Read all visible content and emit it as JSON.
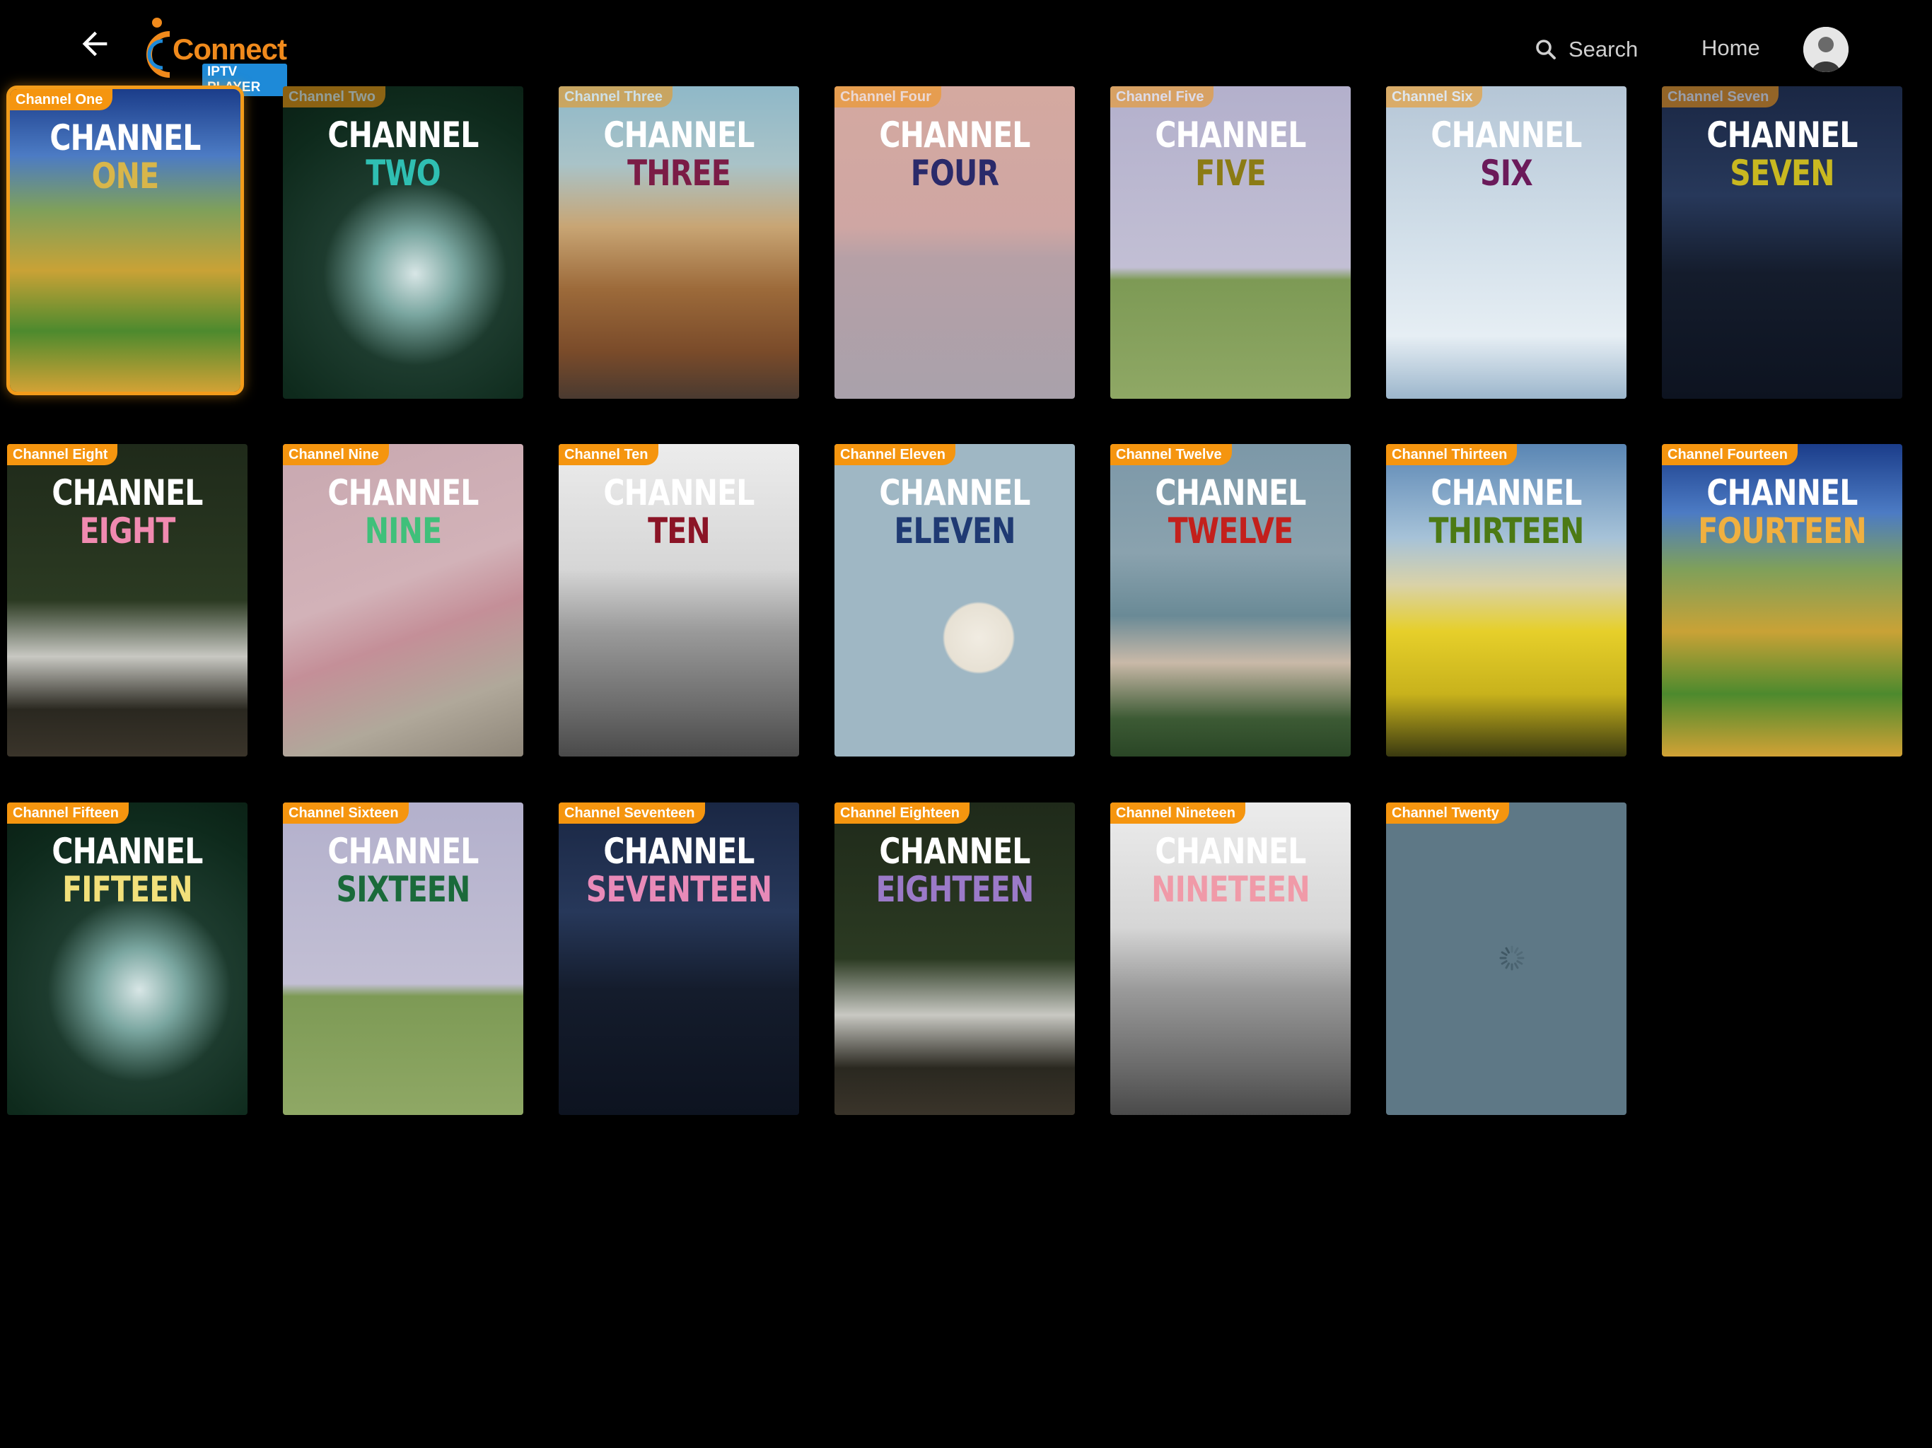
{
  "header": {
    "logo_word": "Connect",
    "logo_badge": "IPTV PLAYER",
    "search_label": "Search",
    "home_label": "Home"
  },
  "colors": {
    "accent": "#f5950f",
    "logo_blue": "#1e8ad8",
    "background": "#000000"
  },
  "channels": [
    {
      "tag": "Channel One",
      "line1": "CHANNEL",
      "line2": "ONE",
      "line2_color": "#d8b64a",
      "bg": "linear-gradient(180deg,#1b3d8a 0%,#4c7bc4 22%,#7fa05a 40%,#c9a236 60%,#4d8a2e 80%,#d2a235 100%)"
    },
    {
      "tag": "Channel Two",
      "line1": "CHANNEL",
      "line2": "TWO",
      "line2_color": "#2fbfb2",
      "bg": "radial-gradient(circle at 55% 60%,#d8e6e6 0%,#7aa6a0 18%,#1d3b2e 40%,#0e2a1c 75%,#0a1f14 100%)"
    },
    {
      "tag": "Channel Three",
      "line1": "CHANNEL",
      "line2": "THREE",
      "line2_color": "#7b1c46",
      "bg": "linear-gradient(180deg,#8fb8c8 0%,#a9c3c8 25%,#c8a574 45%,#9c6a3a 65%,#7a4b2a 85%,#4a3a30 100%)"
    },
    {
      "tag": "Channel Four",
      "line1": "CHANNEL",
      "line2": "FOUR",
      "line2_color": "#2a2a6a",
      "bg": "linear-gradient(180deg,#d4a9a0 0%,#cfa6a3 45%,#b6a0a6 55%,#a9a1ab 100%)"
    },
    {
      "tag": "Channel Five",
      "line1": "CHANNEL",
      "line2": "FIVE",
      "line2_color": "#8b7b14",
      "bg": "linear-gradient(180deg,#b3b0cc 0%,#c2bfd4 58%,#7d9a55 62%,#8fa865 100%)"
    },
    {
      "tag": "Channel Six",
      "line1": "CHANNEL",
      "line2": "SIX",
      "line2_color": "#6b1a5a",
      "bg": "linear-gradient(180deg,#b5c6d6 0%,#d3e0ea 50%,#e6eef4 80%,#9cb6cc 100%)"
    },
    {
      "tag": "Channel Seven",
      "line1": "CHANNEL",
      "line2": "SEVEN",
      "line2_color": "#c9b820",
      "bg": "linear-gradient(180deg,#1a2744 0%,#27385a 35%,#141c2c 60%,#0d1320 100%)"
    },
    {
      "tag": "Channel Eight",
      "line1": "CHANNEL",
      "line2": "EIGHT",
      "line2_color": "#f08ab0",
      "bg": "linear-gradient(180deg,#1f2a1a 0%,#2b3a22 50%,#c8c8c2 68%,#2a2820 85%,#3a342a 100%)"
    },
    {
      "tag": "Channel Nine",
      "line1": "CHANNEL",
      "line2": "NINE",
      "line2_color": "#3fc07a",
      "bg": "linear-gradient(160deg,#c8a8b0 0%,#d2b2b8 45%,#c48f98 60%,#b0a89a 80%,#8e8679 100%)"
    },
    {
      "tag": "Channel Ten",
      "line1": "CHANNEL",
      "line2": "TEN",
      "line2_color": "#8b1426",
      "bg": "linear-gradient(180deg,#ececec 0%,#d6d6d6 40%,#9a9a9a 60%,#6a6a6a 85%,#4a4a4a 100%)"
    },
    {
      "tag": "Channel Eleven",
      "line1": "CHANNEL",
      "line2": "ELEVEN",
      "line2_color": "#1f3a73",
      "bg": "radial-gradient(circle at 60% 62%,#f1ece2 0%,#e7e1d4 14%,#9fb7c4 15%,#9fb7c4 100%)"
    },
    {
      "tag": "Channel Twelve",
      "line1": "CHANNEL",
      "line2": "TWELVE",
      "line2_color": "#c3201c",
      "bg": "linear-gradient(180deg,#7c98a8 0%,#8aa2ae 35%,#6a8a96 55%,#c9b9a8 70%,#3c5a34 88%,#2a4626 100%)"
    },
    {
      "tag": "Channel Thirteen",
      "line1": "CHANNEL",
      "line2": "THIRTEEN",
      "line2_color": "#4c7a14",
      "bg": "linear-gradient(180deg,#5a86b4 0%,#a6c2d8 30%,#d9d2a8 45%,#e6cf2a 60%,#c8b21c 80%,#3a3a10 100%)"
    },
    {
      "tag": "Channel Fourteen",
      "line1": "CHANNEL",
      "line2": "FOURTEEN",
      "line2_color": "#f0b040",
      "bg": "linear-gradient(180deg,#1b3d8a 0%,#4c7bc4 22%,#7fa05a 40%,#c9a236 60%,#4d8a2e 80%,#d2a235 100%)"
    },
    {
      "tag": "Channel Fifteen",
      "line1": "CHANNEL",
      "line2": "FIFTEEN",
      "line2_color": "#f2e07a",
      "bg": "radial-gradient(circle at 55% 60%,#d8e6e6 0%,#7aa6a0 18%,#1d3b2e 40%,#0e2a1c 75%,#0a1f14 100%)"
    },
    {
      "tag": "Channel Sixteen",
      "line1": "CHANNEL",
      "line2": "SIXTEEN",
      "line2_color": "#1a6a3a",
      "bg": "linear-gradient(180deg,#b3b0cc 0%,#c2bfd4 58%,#7d9a55 62%,#8fa865 100%)"
    },
    {
      "tag": "Channel Seventeen",
      "line1": "CHANNEL",
      "line2": "SEVENTEEN",
      "line2_color": "#e88ab8",
      "bg": "linear-gradient(180deg,#1a2744 0%,#27385a 35%,#141c2c 60%,#0d1320 100%)"
    },
    {
      "tag": "Channel Eighteen",
      "line1": "CHANNEL",
      "line2": "EIGHTEEN",
      "line2_color": "#9b7ac8",
      "bg": "linear-gradient(180deg,#1f2a1a 0%,#2b3a22 50%,#c8c8c2 68%,#2a2820 85%,#3a342a 100%)"
    },
    {
      "tag": "Channel Nineteen",
      "line1": "CHANNEL",
      "line2": "NINETEEN",
      "line2_color": "#f09aa8",
      "bg": "linear-gradient(180deg,#ececec 0%,#d6d6d6 40%,#9a9a9a 60%,#6a6a6a 85%,#4a4a4a 100%)"
    },
    {
      "tag": "Channel Twenty",
      "line1": "",
      "line2": "",
      "line2_color": "#ffffff",
      "bg": "#5e7886",
      "loading": true
    }
  ]
}
